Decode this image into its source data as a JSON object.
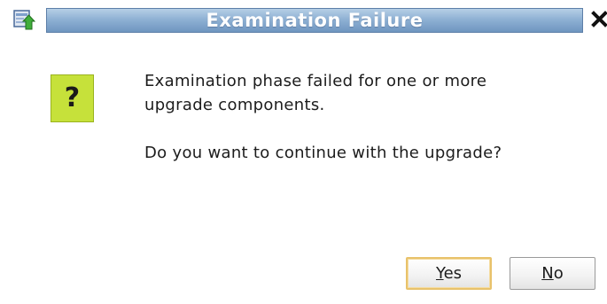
{
  "dialog": {
    "title": "Examination Failure",
    "icon": "question-icon",
    "icon_glyph": "?",
    "message_line1": "Examination phase failed for one or more",
    "message_line2": "upgrade components.",
    "question": "Do you want to continue with the upgrade?"
  },
  "buttons": {
    "yes_mnemonic": "Y",
    "yes_rest": "es",
    "no_mnemonic": "N",
    "no_rest": "o"
  },
  "colors": {
    "title_bar": "#8fb1d4",
    "question_icon_bg": "#c6e13a",
    "default_button_border": "#e8c26b"
  }
}
